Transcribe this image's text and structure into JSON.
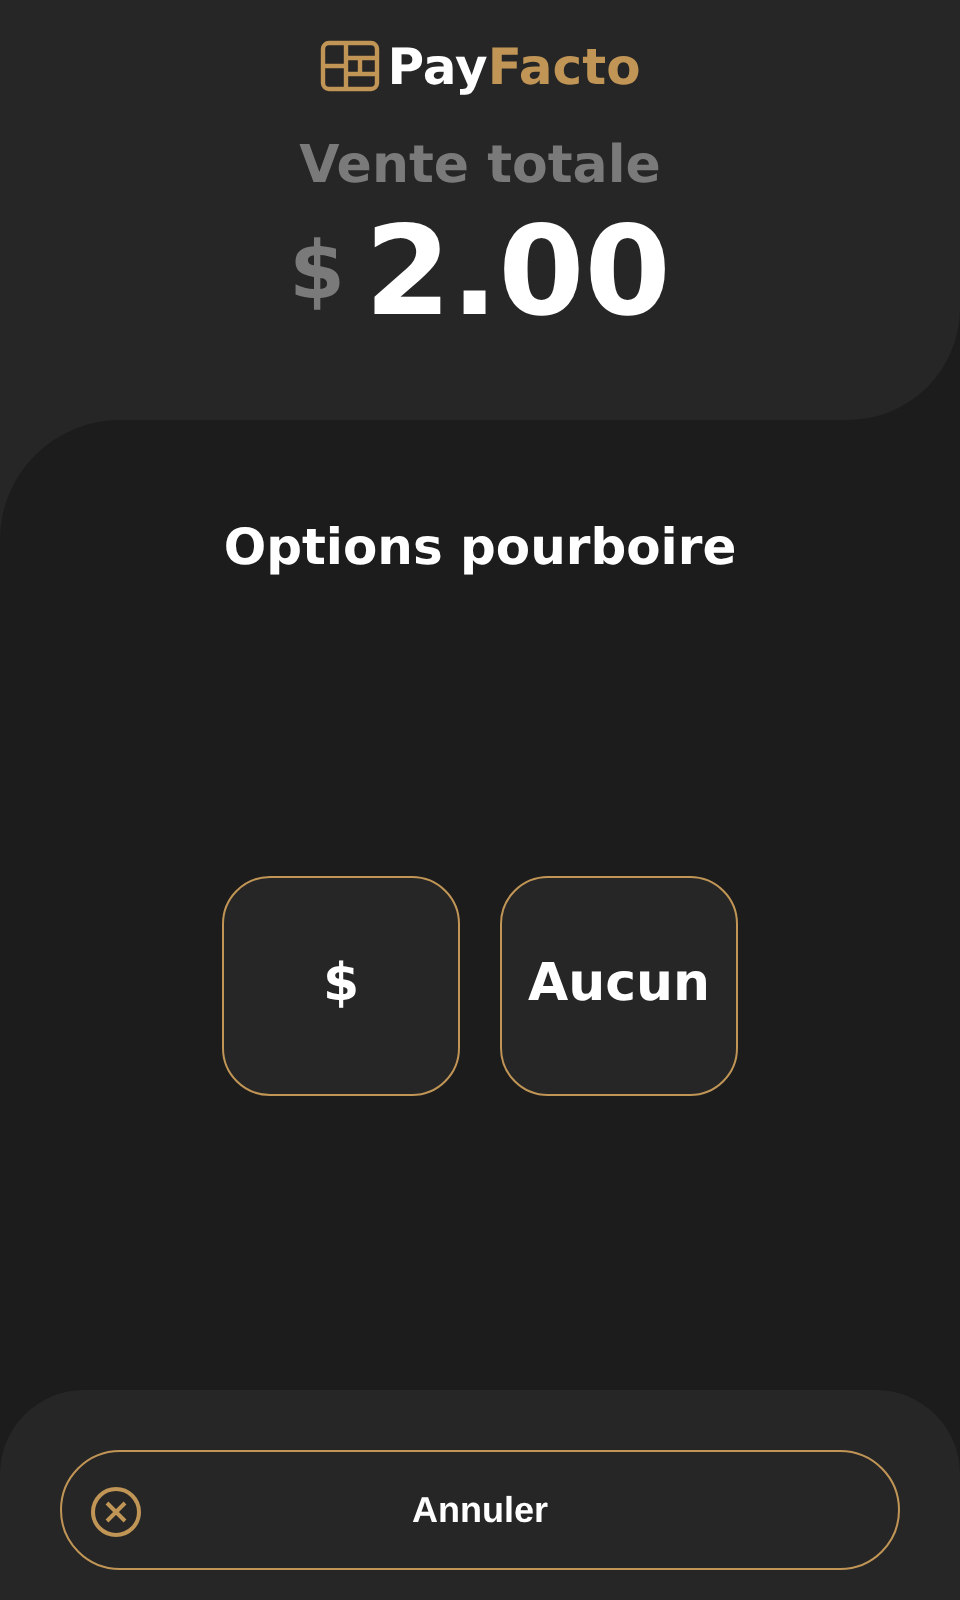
{
  "logo": {
    "part_1": "Pay",
    "part_2": "Facto"
  },
  "sale": {
    "label": "Vente totale",
    "currency": "$",
    "amount": "2.00"
  },
  "tip": {
    "title": "Options pourboire",
    "options": [
      {
        "label": "$"
      },
      {
        "label": "Aucun"
      }
    ]
  },
  "cancel_button": {
    "label": "Annuler"
  }
}
